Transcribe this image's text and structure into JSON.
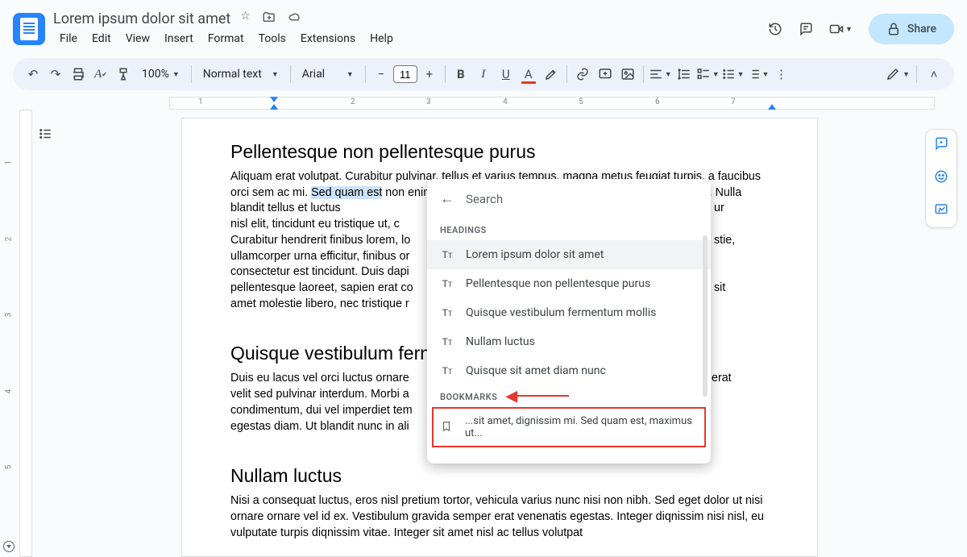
{
  "header": {
    "title": "Lorem ipsum dolor sit amet",
    "menu": [
      "File",
      "Edit",
      "View",
      "Insert",
      "Format",
      "Tools",
      "Extensions",
      "Help"
    ],
    "share_label": "Share"
  },
  "toolbar": {
    "zoom": "100%",
    "paragraph_style": "Normal text",
    "font": "Arial",
    "font_size": "11"
  },
  "ruler": {
    "h": [
      "1",
      "2",
      "3",
      "4",
      "5",
      "6",
      "7"
    ],
    "v": [
      "1",
      "2",
      "3",
      "4",
      "5"
    ]
  },
  "document": {
    "h1": "Pellentesque non pellentesque purus",
    "p1a": "Aliquam erat volutpat. Curabitur pulvinar, tellus et varius tempus, magna metus feugiat turpis, a faucibus orci sem ac mi. ",
    "p1_sel": "Sed quam est",
    "p1b": " non enim lacinia faucibus. Pellentesque faucibus sagittis lacinia. Nulla blandit tellus et luctus",
    "p1c_right": "ur",
    "p2a": "nisl elit, tincidunt eu tristique ut, c",
    "p3a": "Curabitur hendrerit finibus lorem, lo",
    "p3c_right": "stie,",
    "p4a": "ullamcorper urna efficitur, finibus or",
    "p5a": "consectetur est tincidunt. Duis dapi",
    "p6a": "pellentesque laoreet, sapien erat co",
    "p6c_right": "sit",
    "p7a": "amet molestie libero, nec tristique r",
    "h2": "Quisque vestibulum fern",
    "p8a": "Duis eu lacus vel orci luctus ornare",
    "p8c_right": "erat",
    "p9a": "velit sed pulvinar interdum. Morbi a",
    "p10a": "condimentum, dui vel imperdiet tem",
    "p11a": "egestas diam. Ut blandit nunc in ali",
    "h3": "Nullam luctus",
    "p12": "Nisi a consequat luctus, eros nisl pretium tortor, vehicula varius nunc nisi non nibh. Sed eget dolor ut nisi ornare ornare vel id ex. Vestibulum gravida semper erat venenatis egestas. Integer diqnissim nisi nisl, eu vulputate turpis diqnissim vitae. Integer sit amet nisl ac tellus volutpat"
  },
  "search_panel": {
    "placeholder": "Search",
    "headings_label": "HEADINGS",
    "bookmarks_label": "BOOKMARKS",
    "headings": [
      "Lorem ipsum dolor sit amet",
      "Pellentesque non pellentesque purus",
      "Quisque vestibulum fermentum mollis",
      "Nullam luctus",
      "Quisque sit amet diam nunc"
    ],
    "bookmark": "...sit amet, dignissim mi. Sed quam est, maximus ut..."
  }
}
